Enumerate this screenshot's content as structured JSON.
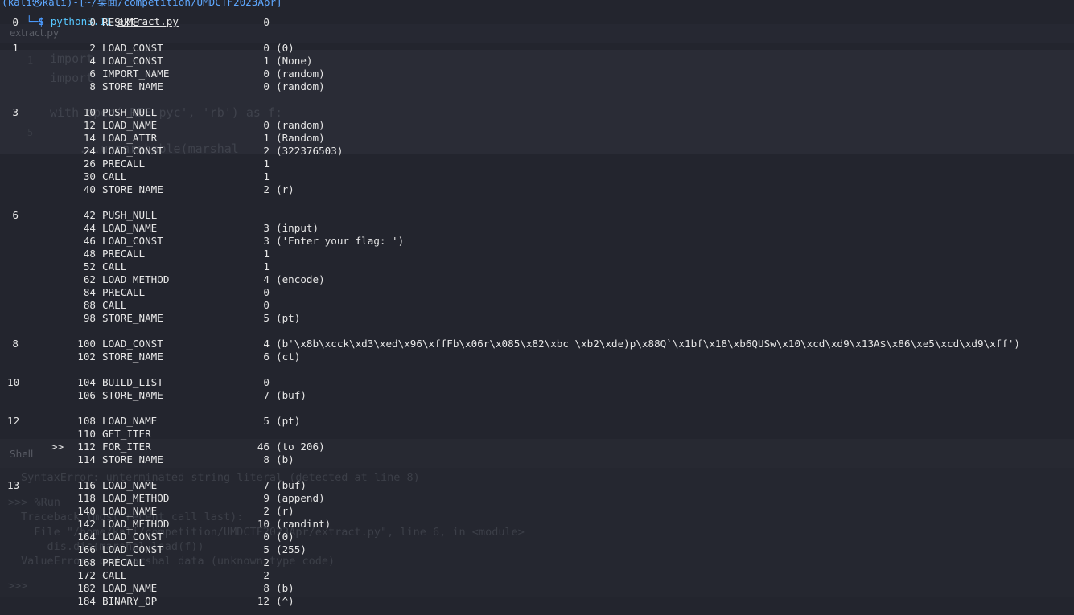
{
  "terminal": {
    "header_hint": "(kali㉿kali)-[~/桌面/competition/UMDCTF2023Apr]",
    "prompt_symbol": "└─$",
    "command": "python3.11",
    "argument": "extract.py"
  },
  "background": {
    "tab_label": "extract.py",
    "shell_label": "Shell",
    "code_lines": [
      "import",
      "import",
      "with open('REE.pyc', 'rb') as f:",
      "    ...unmarshable(marshal"
    ],
    "shell_lines": [
      "SyntaxError: unterminated string literal (detected at line 8)",
      ">>> %Run",
      "Traceback (most recent call last):",
      "  File \"/home/kali/competition/UMDCTF2023Apr/extract.py\", line 6, in <module>",
      "    dis.dis(marshal.load(f))",
      "ValueError: bad marshal data (unknown type code)",
      ">>>"
    ]
  },
  "disassembly": [
    {
      "line": "0",
      "mark": "",
      "offset": "0",
      "op": "RESUME",
      "arg": "0",
      "repr": ""
    },
    {
      "line": "",
      "mark": "",
      "offset": "",
      "op": "",
      "arg": "",
      "repr": ""
    },
    {
      "line": "1",
      "mark": "",
      "offset": "2",
      "op": "LOAD_CONST",
      "arg": "0",
      "repr": "(0)"
    },
    {
      "line": "",
      "mark": "",
      "offset": "4",
      "op": "LOAD_CONST",
      "arg": "1",
      "repr": "(None)"
    },
    {
      "line": "",
      "mark": "",
      "offset": "6",
      "op": "IMPORT_NAME",
      "arg": "0",
      "repr": "(random)"
    },
    {
      "line": "",
      "mark": "",
      "offset": "8",
      "op": "STORE_NAME",
      "arg": "0",
      "repr": "(random)"
    },
    {
      "line": "",
      "mark": "",
      "offset": "",
      "op": "",
      "arg": "",
      "repr": ""
    },
    {
      "line": "3",
      "mark": "",
      "offset": "10",
      "op": "PUSH_NULL",
      "arg": "",
      "repr": ""
    },
    {
      "line": "",
      "mark": "",
      "offset": "12",
      "op": "LOAD_NAME",
      "arg": "0",
      "repr": "(random)"
    },
    {
      "line": "",
      "mark": "",
      "offset": "14",
      "op": "LOAD_ATTR",
      "arg": "1",
      "repr": "(Random)"
    },
    {
      "line": "",
      "mark": "",
      "offset": "24",
      "op": "LOAD_CONST",
      "arg": "2",
      "repr": "(322376503)"
    },
    {
      "line": "",
      "mark": "",
      "offset": "26",
      "op": "PRECALL",
      "arg": "1",
      "repr": ""
    },
    {
      "line": "",
      "mark": "",
      "offset": "30",
      "op": "CALL",
      "arg": "1",
      "repr": ""
    },
    {
      "line": "",
      "mark": "",
      "offset": "40",
      "op": "STORE_NAME",
      "arg": "2",
      "repr": "(r)"
    },
    {
      "line": "",
      "mark": "",
      "offset": "",
      "op": "",
      "arg": "",
      "repr": ""
    },
    {
      "line": "6",
      "mark": "",
      "offset": "42",
      "op": "PUSH_NULL",
      "arg": "",
      "repr": ""
    },
    {
      "line": "",
      "mark": "",
      "offset": "44",
      "op": "LOAD_NAME",
      "arg": "3",
      "repr": "(input)"
    },
    {
      "line": "",
      "mark": "",
      "offset": "46",
      "op": "LOAD_CONST",
      "arg": "3",
      "repr": "('Enter your flag: ')"
    },
    {
      "line": "",
      "mark": "",
      "offset": "48",
      "op": "PRECALL",
      "arg": "1",
      "repr": ""
    },
    {
      "line": "",
      "mark": "",
      "offset": "52",
      "op": "CALL",
      "arg": "1",
      "repr": ""
    },
    {
      "line": "",
      "mark": "",
      "offset": "62",
      "op": "LOAD_METHOD",
      "arg": "4",
      "repr": "(encode)"
    },
    {
      "line": "",
      "mark": "",
      "offset": "84",
      "op": "PRECALL",
      "arg": "0",
      "repr": ""
    },
    {
      "line": "",
      "mark": "",
      "offset": "88",
      "op": "CALL",
      "arg": "0",
      "repr": ""
    },
    {
      "line": "",
      "mark": "",
      "offset": "98",
      "op": "STORE_NAME",
      "arg": "5",
      "repr": "(pt)"
    },
    {
      "line": "",
      "mark": "",
      "offset": "",
      "op": "",
      "arg": "",
      "repr": ""
    },
    {
      "line": "8",
      "mark": "",
      "offset": "100",
      "op": "LOAD_CONST",
      "arg": "4",
      "repr": "(b'\\x8b\\xcck\\xd3\\xed\\x96\\xffFb\\x06r\\x085\\x82\\xbc \\xb2\\xde)p\\x88Q`\\x1bf\\x18\\xb6QUSw\\x10\\xcd\\xd9\\x13A$\\x86\\xe5\\xcd\\xd9\\xff')"
    },
    {
      "line": "",
      "mark": "",
      "offset": "102",
      "op": "STORE_NAME",
      "arg": "6",
      "repr": "(ct)"
    },
    {
      "line": "",
      "mark": "",
      "offset": "",
      "op": "",
      "arg": "",
      "repr": ""
    },
    {
      "line": "10",
      "mark": "",
      "offset": "104",
      "op": "BUILD_LIST",
      "arg": "0",
      "repr": ""
    },
    {
      "line": "",
      "mark": "",
      "offset": "106",
      "op": "STORE_NAME",
      "arg": "7",
      "repr": "(buf)"
    },
    {
      "line": "",
      "mark": "",
      "offset": "",
      "op": "",
      "arg": "",
      "repr": ""
    },
    {
      "line": "12",
      "mark": "",
      "offset": "108",
      "op": "LOAD_NAME",
      "arg": "5",
      "repr": "(pt)"
    },
    {
      "line": "",
      "mark": "",
      "offset": "110",
      "op": "GET_ITER",
      "arg": "",
      "repr": ""
    },
    {
      "line": "",
      "mark": ">>",
      "offset": "112",
      "op": "FOR_ITER",
      "arg": "46",
      "repr": "(to 206)"
    },
    {
      "line": "",
      "mark": "",
      "offset": "114",
      "op": "STORE_NAME",
      "arg": "8",
      "repr": "(b)"
    },
    {
      "line": "",
      "mark": "",
      "offset": "",
      "op": "",
      "arg": "",
      "repr": ""
    },
    {
      "line": "13",
      "mark": "",
      "offset": "116",
      "op": "LOAD_NAME",
      "arg": "7",
      "repr": "(buf)"
    },
    {
      "line": "",
      "mark": "",
      "offset": "118",
      "op": "LOAD_METHOD",
      "arg": "9",
      "repr": "(append)"
    },
    {
      "line": "",
      "mark": "",
      "offset": "140",
      "op": "LOAD_NAME",
      "arg": "2",
      "repr": "(r)"
    },
    {
      "line": "",
      "mark": "",
      "offset": "142",
      "op": "LOAD_METHOD",
      "arg": "10",
      "repr": "(randint)"
    },
    {
      "line": "",
      "mark": "",
      "offset": "164",
      "op": "LOAD_CONST",
      "arg": "0",
      "repr": "(0)"
    },
    {
      "line": "",
      "mark": "",
      "offset": "166",
      "op": "LOAD_CONST",
      "arg": "5",
      "repr": "(255)"
    },
    {
      "line": "",
      "mark": "",
      "offset": "168",
      "op": "PRECALL",
      "arg": "2",
      "repr": ""
    },
    {
      "line": "",
      "mark": "",
      "offset": "172",
      "op": "CALL",
      "arg": "2",
      "repr": ""
    },
    {
      "line": "",
      "mark": "",
      "offset": "182",
      "op": "LOAD_NAME",
      "arg": "8",
      "repr": "(b)"
    },
    {
      "line": "",
      "mark": "",
      "offset": "184",
      "op": "BINARY_OP",
      "arg": "12",
      "repr": "(^)"
    }
  ]
}
